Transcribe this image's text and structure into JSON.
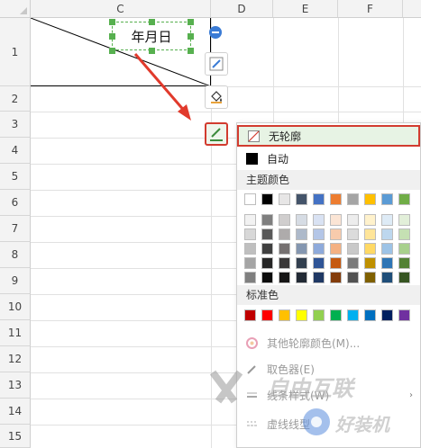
{
  "columns": [
    "C",
    "D",
    "E",
    "F"
  ],
  "rows": [
    "1",
    "2",
    "3",
    "4",
    "5",
    "6",
    "7",
    "8",
    "9",
    "10",
    "11",
    "12",
    "13",
    "14",
    "15"
  ],
  "cell_text": "年月日",
  "menu": {
    "no_outline": "无轮廓",
    "automatic": "自动",
    "theme_colors_title": "主题颜色",
    "standard_colors_title": "标准色",
    "more_outline_colors": "其他轮廓颜色(M)...",
    "eyedropper": "取色器(E)",
    "line_style": "线条样式(W)",
    "dash_style": "虚线线型"
  },
  "theme_row_top": [
    "#ffffff",
    "#000000",
    "#e7e6e6",
    "#44546a",
    "#4472c4",
    "#ed7d31",
    "#a5a5a5",
    "#ffc000",
    "#5b9bd5",
    "#70ad47"
  ],
  "theme_shades": [
    [
      "#f2f2f2",
      "#7f7f7f",
      "#d0cece",
      "#d6dce4",
      "#d9e2f3",
      "#fbe5d5",
      "#ededed",
      "#fff2cc",
      "#deebf6",
      "#e2efd9"
    ],
    [
      "#d8d8d8",
      "#595959",
      "#aeabab",
      "#adb9ca",
      "#b4c6e7",
      "#f7cbac",
      "#dbdbdb",
      "#ffe599",
      "#bdd7ee",
      "#c5e0b3"
    ],
    [
      "#bfbfbf",
      "#3f3f3f",
      "#757070",
      "#8496b0",
      "#8eaadb",
      "#f4b183",
      "#c9c9c9",
      "#ffd965",
      "#9dc3e6",
      "#a8d08d"
    ],
    [
      "#a5a5a5",
      "#262626",
      "#3a3838",
      "#323f4f",
      "#2f5496",
      "#c55a11",
      "#7b7b7b",
      "#bf9000",
      "#2e75b5",
      "#538135"
    ],
    [
      "#7f7f7f",
      "#0c0c0c",
      "#171616",
      "#222a35",
      "#1f3864",
      "#833c0b",
      "#525252",
      "#7f6000",
      "#1f4e79",
      "#375623"
    ]
  ],
  "standard_colors": [
    "#c00000",
    "#ff0000",
    "#ffc000",
    "#ffff00",
    "#92d050",
    "#00b050",
    "#00b0f0",
    "#0070c0",
    "#002060",
    "#7030a0"
  ],
  "watermark": {
    "text1": "自由互联",
    "text2": "好装机"
  }
}
